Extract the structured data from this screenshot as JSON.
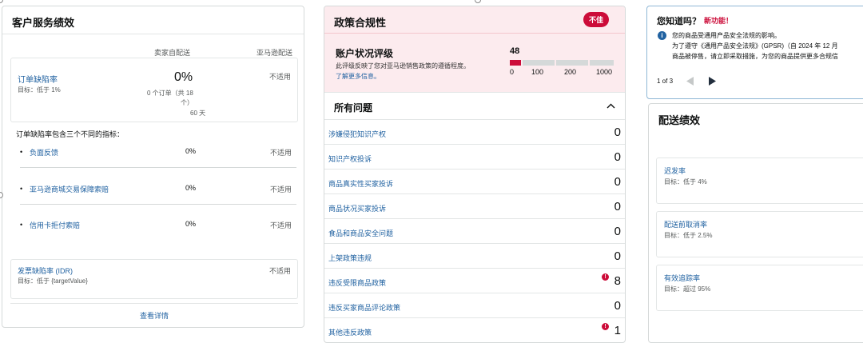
{
  "customer_service": {
    "title": "客户服务绩效",
    "col_seller": "卖家自配送",
    "col_amazon": "亚马逊配送",
    "odr": {
      "label": "订单缺陷率",
      "target": "目标：低于 1%",
      "value": "0%",
      "detail_1": "0 个订单（共 18",
      "detail_2": "个）",
      "detail_3": "60 天",
      "amazon_value": "不适用"
    },
    "intro": "订单缺陷率包含三个不同的指标：",
    "indicators": [
      {
        "label": "负面反馈",
        "value": "0%",
        "amazon": "不适用"
      },
      {
        "label": "亚马逊商城交易保障索赔",
        "value": "0%",
        "amazon": "不适用"
      },
      {
        "label": "信用卡拒付索赔",
        "value": "0%",
        "amazon": "不适用"
      }
    ],
    "idr": {
      "label": "发票缺陷率 (IDR)",
      "target": "目标：低于 {targetValue}",
      "value": "不适用"
    },
    "footer_link": "查看详情"
  },
  "policy": {
    "title": "政策合规性",
    "badge": "不佳",
    "ahr_title": "账户状况评级",
    "ahr_desc": "此评级反映了您对亚马逊销售政策的遵循程度。",
    "ahr_link": "了解更多信息。",
    "ahr_score": "48",
    "ahr_score_fraction": 0.048,
    "scale": [
      "0",
      "100",
      "200",
      "1000"
    ],
    "all_issues": "所有问题",
    "issues": [
      {
        "label": "涉嫌侵犯知识产权",
        "count": "0",
        "alert": false
      },
      {
        "label": "知识产权投诉",
        "count": "0",
        "alert": false
      },
      {
        "label": "商品真实性买家投诉",
        "count": "0",
        "alert": false
      },
      {
        "label": "商品状况买家投诉",
        "count": "0",
        "alert": false
      },
      {
        "label": "食品和商品安全问题",
        "count": "0",
        "alert": false
      },
      {
        "label": "上架政策违规",
        "count": "0",
        "alert": false
      },
      {
        "label": "违反受限商品政策",
        "count": "8",
        "alert": true
      },
      {
        "label": "违反买家商品评论政策",
        "count": "0",
        "alert": false
      },
      {
        "label": "其他违反政策",
        "count": "1",
        "alert": true
      }
    ]
  },
  "did_you_know": {
    "title": "您知道吗？",
    "new_feature": "新功能！",
    "headline": "您的商品受通用产品安全法规的影响。",
    "line2": "为了遵守《通用产品安全法规》(GPSR)（自 2024 年 12 月",
    "line3": "商品被停售，请立即采取措施，为您的商品提供更多合规信",
    "pager": "1 of 3"
  },
  "delivery": {
    "title": "配送绩效",
    "metrics": [
      {
        "label": "迟发率",
        "target": "目标：低于 4%"
      },
      {
        "label": "配送前取消率",
        "target": "目标：低于 2.5%"
      },
      {
        "label": "有效追踪率",
        "target": "目标：超过 95%"
      }
    ]
  },
  "colors": {
    "accent": "#2162a1",
    "alert": "#cc0c39",
    "alert_bg": "#fcebee"
  }
}
